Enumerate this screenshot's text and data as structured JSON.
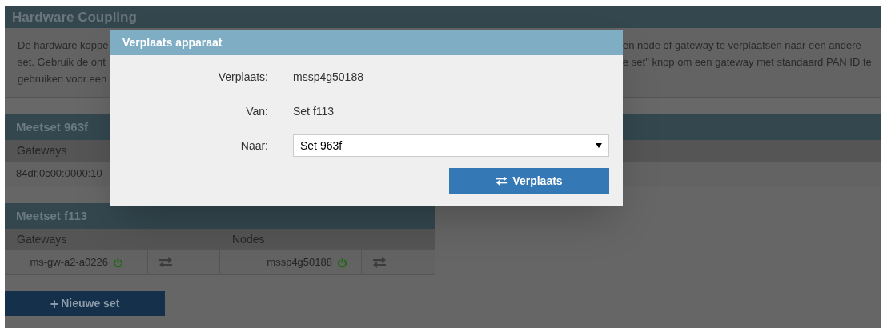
{
  "page": {
    "title": "Hardware Coupling",
    "intro_left": [
      "De hardware koppe",
      "set. Gebruik de ont",
      "gebruiken voor een"
    ],
    "intro_right": [
      "en node of gateway te verplaatsen naar een andere",
      "e set\" knop om een gateway met standaard PAN ID te"
    ]
  },
  "sets": [
    {
      "title": "Meetset 963f",
      "columns": [
        "Gateways"
      ],
      "rows": [
        {
          "gateway": "84df:0c00:0000:10"
        }
      ]
    },
    {
      "title": "Meetset f113",
      "columns": [
        "Gateways",
        "Nodes"
      ],
      "rows": [
        {
          "gateway": "ms-gw-a2-a0226",
          "gateway_online": true,
          "node": "mssp4g50188",
          "node_online": true
        }
      ]
    }
  ],
  "new_set_button": {
    "icon": "+",
    "label": "Nieuwe set"
  },
  "dialog": {
    "title": "Verplaats apparaat",
    "fields": [
      {
        "kind": "text",
        "label": "Verplaats:",
        "value": "mssp4g50188"
      },
      {
        "kind": "text",
        "label": "Van:",
        "value": "Set f113"
      },
      {
        "kind": "select",
        "label": "Naar:",
        "value": "Set 963f"
      }
    ],
    "button": "Verplaats"
  }
}
